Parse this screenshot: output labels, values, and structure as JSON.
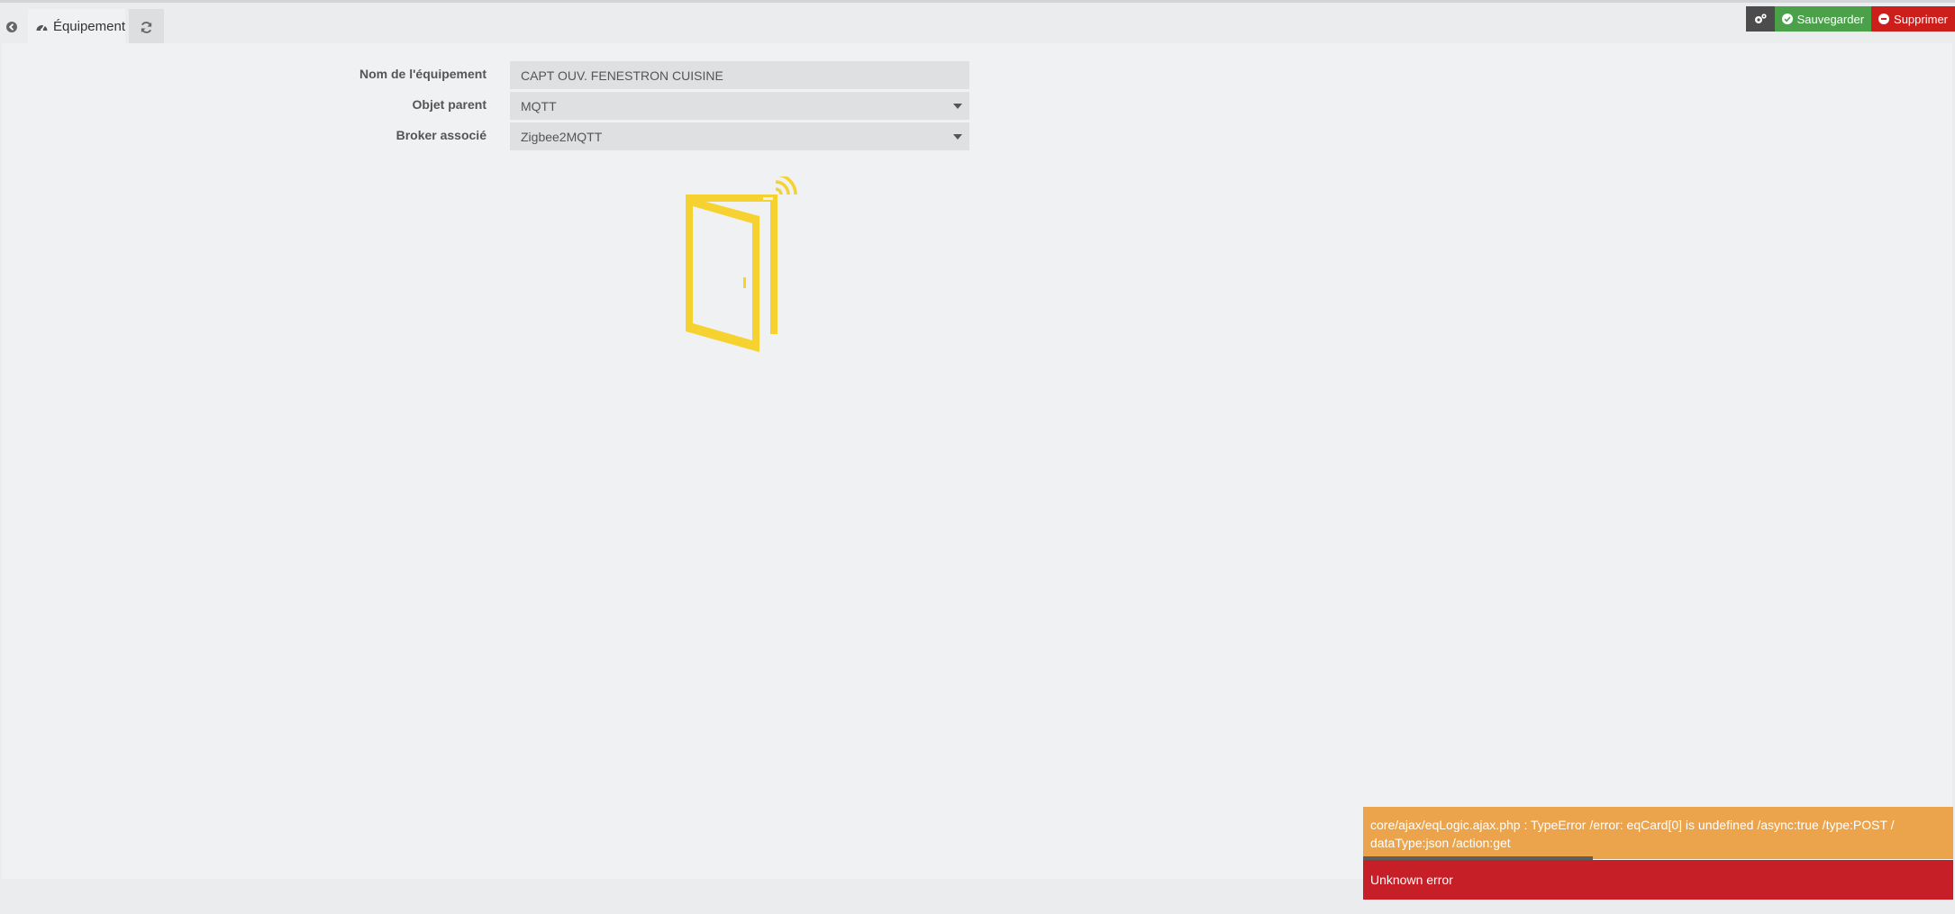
{
  "tabs": {
    "equipment_label": "Équipement"
  },
  "actions": {
    "save_label": "Sauvegarder",
    "delete_label": "Supprimer"
  },
  "form": {
    "name_label": "Nom de l'équipement",
    "name_value": "CAPT OUV. FENESTRON CUISINE",
    "parent_label": "Objet parent",
    "parent_value": "MQTT",
    "broker_label": "Broker associé",
    "broker_value": "Zigbee2MQTT"
  },
  "equipment_icon": "door-sensor-icon",
  "colors": {
    "accent": "#f5d22f",
    "save": "#4ba14a",
    "delete": "#cc1f1c",
    "warning": "#eba44b",
    "error": "#c61f27"
  },
  "notifications": {
    "warning_text": "core/ajax/eqLogic.ajax.php : TypeError /error: eqCard[0] is undefined /async:true /type:POST / dataType:json /action:get",
    "error_text": "Unknown error"
  }
}
